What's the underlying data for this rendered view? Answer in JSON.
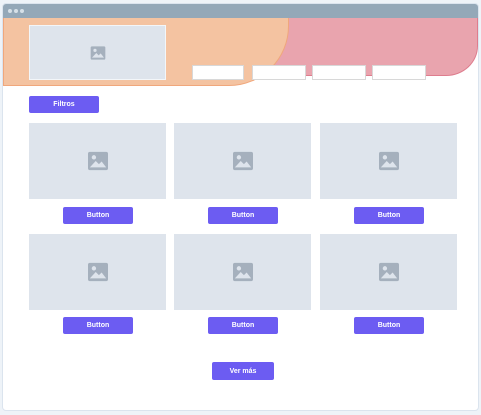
{
  "filters": {
    "label": "Filtros"
  },
  "cards": [
    {
      "button_label": "Button"
    },
    {
      "button_label": "Button"
    },
    {
      "button_label": "Button"
    },
    {
      "button_label": "Button"
    },
    {
      "button_label": "Button"
    },
    {
      "button_label": "Button"
    }
  ],
  "load_more": {
    "label": "Ver más"
  },
  "icons": {
    "placeholder": "image-placeholder-icon"
  },
  "colors": {
    "titlebar": "#94a8b8",
    "hero_orange": "#f4c3a1",
    "hero_pink": "#e9a4ae",
    "placeholder": "#dee4ec",
    "button": "#6c5cf2"
  }
}
